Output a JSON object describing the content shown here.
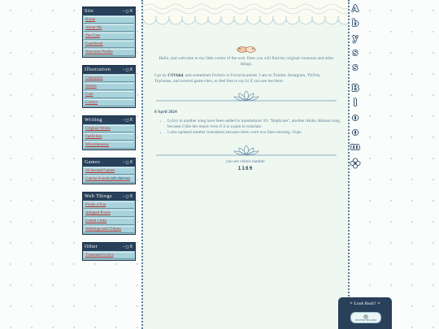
{
  "sidebar": {
    "controls": "–◻X",
    "windows": [
      {
        "title": "Site",
        "items": [
          {
            "label": "Home"
          },
          {
            "label": "About Me"
          },
          {
            "label": "The Cats"
          },
          {
            "label": "Guestbook"
          },
          {
            "label": "Neocities Profile"
          }
        ]
      },
      {
        "title": "Illustration",
        "items": [
          {
            "label": "Characters"
          },
          {
            "label": "Scenes"
          },
          {
            "label": "Cute"
          },
          {
            "label": "Comics"
          }
        ]
      },
      {
        "title": "Writing",
        "items": [
          {
            "label": "Original Works"
          },
          {
            "label": "Fanfiction"
          },
          {
            "label": "Miscellaneous"
          }
        ]
      },
      {
        "title": "Games",
        "items": [
          {
            "label": "20 Second Games"
          },
          {
            "label": "Gatcha Sounds",
            "note": "(sfx tbd on)"
          }
        ]
      },
      {
        "title": "Web Things",
        "items": [
          {
            "label": "Pixels 4 You"
          },
          {
            "label": "Adopted Pixels"
          },
          {
            "label": "Useful Links"
          },
          {
            "label": "Webrings and Cliques"
          }
        ]
      },
      {
        "title": "Other",
        "items": [
          {
            "label": "Translated Lyrics"
          }
        ]
      }
    ]
  },
  "main": {
    "intro_1": "Hello, and welcome to my little corner of the web. Here you will find my original creations and other things.",
    "intro_2_pre": "I go by ",
    "intro_2_name": "CSVidal",
    "intro_2_post": ", and sometimes Forlorn or ForlornLament. I am on Tumblr, Instagram, TikTok, Toyhouse, and several game sites, so feel free to say hi if you see me there.",
    "news_date": "8 April 2024",
    "news_items": [
      "Lyrics to another song have been added to translations! It's \"Replicare\", another Akiko Shikata song, because I like her music even if it is a pain to translate.",
      "I also updated another translation because there were two lines missing. Oops."
    ],
    "visitor_text": "you are visitor number",
    "visitor_count": "1169"
  },
  "side_title": {
    "letters": [
      "A",
      "b",
      "y",
      "s",
      "s",
      "B",
      "l",
      "o",
      "o",
      "m"
    ]
  },
  "lookback": {
    "title": "✧ Look Back? ✧",
    "badge_text": "UNITED BLOOM"
  },
  "colors": {
    "navy": "#28405a",
    "panel": "#eef8f1",
    "link": "#b5352f",
    "sidebar_item": "#a9d3dc",
    "text": "#5e7a93"
  }
}
